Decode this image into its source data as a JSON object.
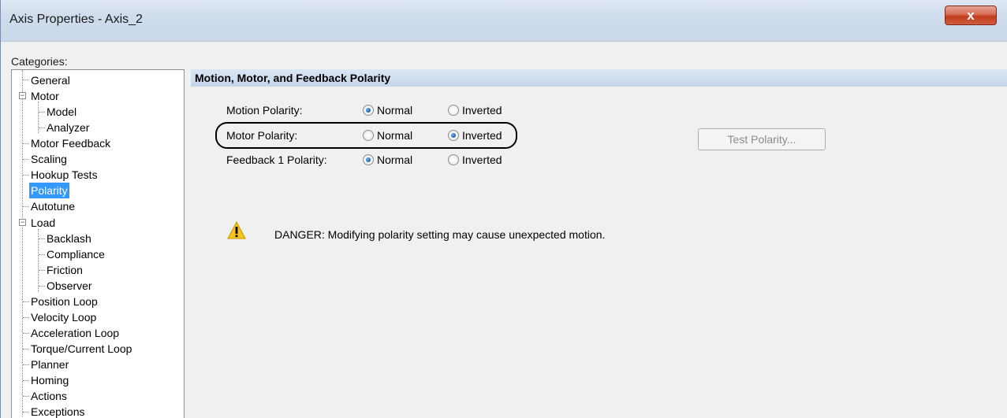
{
  "window": {
    "title": "Axis Properties - Axis_2",
    "close_symbol": "x"
  },
  "categories": {
    "label": "Categories:",
    "items": [
      {
        "label": "General",
        "level": 0
      },
      {
        "label": "Motor",
        "level": 0,
        "expander": "−"
      },
      {
        "label": "Model",
        "level": 1
      },
      {
        "label": "Analyzer",
        "level": 1
      },
      {
        "label": "Motor Feedback",
        "level": 0
      },
      {
        "label": "Scaling",
        "level": 0
      },
      {
        "label": "Hookup Tests",
        "level": 0
      },
      {
        "label": "Polarity",
        "level": 0,
        "selected": true
      },
      {
        "label": "Autotune",
        "level": 0
      },
      {
        "label": "Load",
        "level": 0,
        "expander": "−"
      },
      {
        "label": "Backlash",
        "level": 1
      },
      {
        "label": "Compliance",
        "level": 1
      },
      {
        "label": "Friction",
        "level": 1
      },
      {
        "label": "Observer",
        "level": 1
      },
      {
        "label": "Position Loop",
        "level": 0
      },
      {
        "label": "Velocity Loop",
        "level": 0
      },
      {
        "label": "Acceleration Loop",
        "level": 0
      },
      {
        "label": "Torque/Current Loop",
        "level": 0
      },
      {
        "label": "Planner",
        "level": 0
      },
      {
        "label": "Homing",
        "level": 0
      },
      {
        "label": "Actions",
        "level": 0
      },
      {
        "label": "Exceptions",
        "level": 0
      }
    ]
  },
  "polarity": {
    "section_title": "Motion, Motor, and Feedback Polarity",
    "rows": [
      {
        "label": "Motion Polarity:",
        "normal": "Normal",
        "inverted": "Inverted",
        "selected": "Normal"
      },
      {
        "label": "Motor Polarity:",
        "normal": "Normal",
        "inverted": "Inverted",
        "selected": "Inverted"
      },
      {
        "label": "Feedback 1 Polarity:",
        "normal": "Normal",
        "inverted": "Inverted",
        "selected": "Normal"
      }
    ],
    "test_button": "Test Polarity...",
    "warning_icon": "warning-triangle-icon",
    "warning_text": "DANGER: Modifying polarity setting may cause unexpected motion."
  },
  "colors": {
    "selection": "#3399ff",
    "warning": "#f5c518"
  }
}
